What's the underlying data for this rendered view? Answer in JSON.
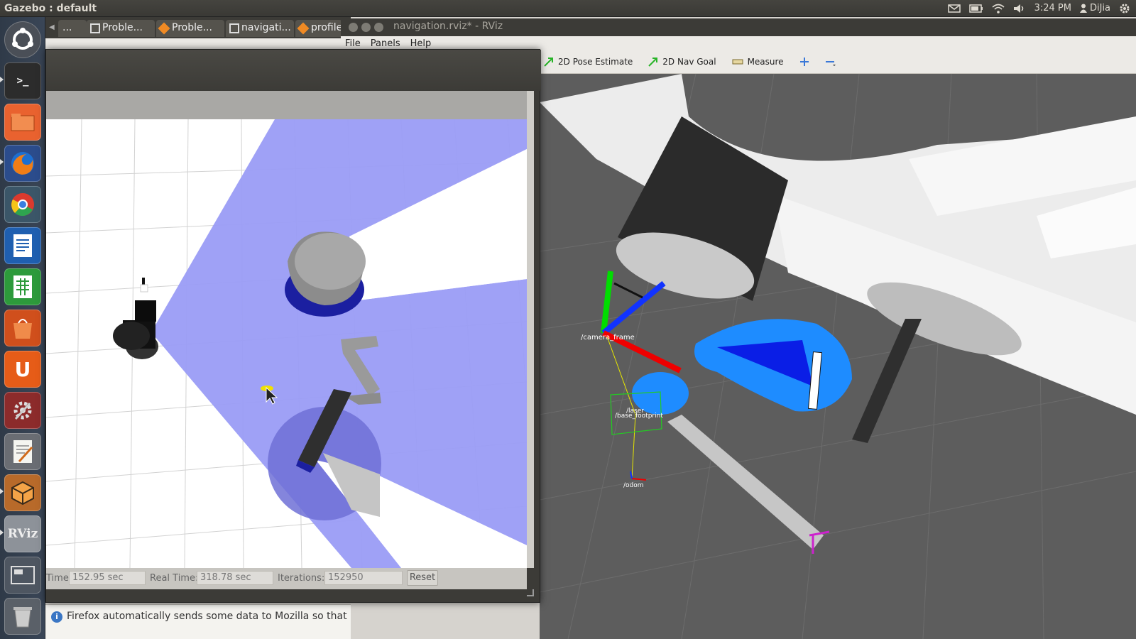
{
  "top_panel": {
    "title": "Gazebo : default",
    "clock": "3:24 PM",
    "user": "DiJia",
    "icons": [
      "mail-icon",
      "battery-icon",
      "wifi-icon",
      "volume-icon",
      "user-icon",
      "gear-icon"
    ]
  },
  "launcher": {
    "items": [
      "ubuntu-dash-icon",
      "terminal-icon",
      "files-icon",
      "firefox-icon",
      "chrome-icon",
      "writer-icon",
      "calc-icon",
      "software-center-icon",
      "ubuntu-one-icon",
      "system-settings-icon",
      "text-editor-icon",
      "gazebo-icon",
      "rviz-icon",
      "workspace-switcher-icon",
      "trash-icon"
    ],
    "rviz_label": "RViz"
  },
  "browser": {
    "tabs": [
      {
        "label": "..."
      },
      {
        "label": "Proble..."
      },
      {
        "label": "Proble..."
      },
      {
        "label": "navigati..."
      },
      {
        "label": "profile"
      }
    ],
    "notification": "Firefox automatically sends some data to Mozilla so that w"
  },
  "rviz": {
    "title": "navigation.rviz* - RViz",
    "menu": [
      "File",
      "Panels",
      "Help"
    ],
    "tools": {
      "pose_estimate": "2D Pose Estimate",
      "nav_goal": "2D Nav Goal",
      "measure": "Measure"
    },
    "frames": {
      "camera_frame": "/camera_frame",
      "laser": "/laser",
      "base_footprint": "/base_footprint",
      "odom": "/odom"
    },
    "colors": {
      "view_bg": "#5d5d5d",
      "costmap": "#1e8cff",
      "obstacle": "#0a1ee6"
    }
  },
  "gazebo": {
    "status": {
      "sim_time_label": "Time:",
      "sim_time": "152.95 sec",
      "real_time_label": "Real Time:",
      "real_time": "318.78 sec",
      "iterations_label": "Iterations:",
      "iterations": "152950",
      "reset": "Reset"
    },
    "colors": {
      "laser": "#9a9cf5",
      "ground": "#ffffff"
    }
  }
}
